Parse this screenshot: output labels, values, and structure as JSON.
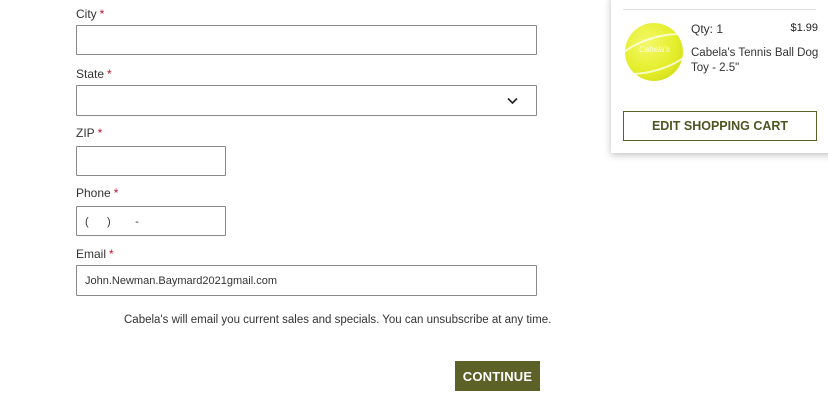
{
  "form": {
    "required_mark": "*",
    "city": {
      "label": "City",
      "value": ""
    },
    "state": {
      "label": "State",
      "value": ""
    },
    "zip": {
      "label": "ZIP",
      "value": ""
    },
    "phone": {
      "label": "Phone",
      "mask": "(      )        -"
    },
    "email": {
      "label": "Email",
      "value": "John.Newman.Baymard2021gmail.com"
    },
    "notice": "Cabela's will email you current sales and specials. You can unsubscribe at any time.",
    "continue_label": "CONTINUE"
  },
  "cart": {
    "item": {
      "qty_label": "Qty: 1",
      "price": "$1.99",
      "name": "Cabela's Tennis Ball Dog Toy - 2.5\"",
      "image_brand": "Cabela's"
    },
    "edit_label": "EDIT SHOPPING CART"
  },
  "colors": {
    "button_olive": "#5b6127",
    "required_red": "#c8102e",
    "ball_yellow": "#e4ee2a"
  },
  "icons": [
    "chevron-down-icon"
  ]
}
